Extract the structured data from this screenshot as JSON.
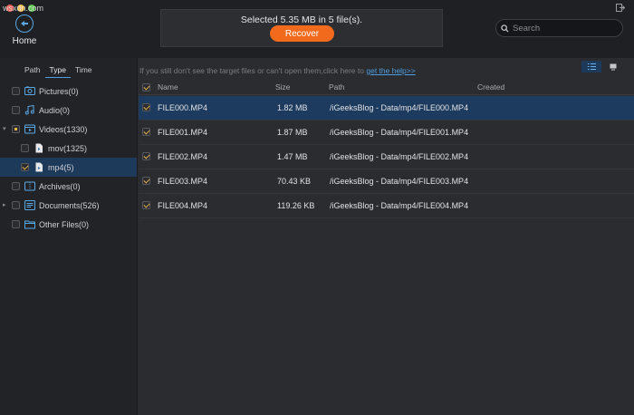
{
  "watermark": "wsxdn.com",
  "header": {
    "home_label": "Home",
    "status_text": "Selected 5.35 MB in 5 file(s).",
    "recover_label": "Recover",
    "search_placeholder": "Search"
  },
  "sidebar": {
    "tabs": [
      "Path",
      "Type",
      "Time"
    ],
    "active_tab": "Type",
    "items": [
      {
        "label": "Pictures(0)",
        "icon": "image-icon",
        "check": "none"
      },
      {
        "label": "Audio(0)",
        "icon": "music-icon",
        "check": "none"
      },
      {
        "label": "Videos(1330)",
        "icon": "video-icon",
        "check": "partial",
        "expanded": true
      },
      {
        "label": "mov(1325)",
        "icon": "file-icon",
        "check": "none",
        "child": true
      },
      {
        "label": "mp4(5)",
        "icon": "file-icon",
        "check": "checked",
        "child": true,
        "selected": true
      },
      {
        "label": "Archives(0)",
        "icon": "archive-icon",
        "check": "none"
      },
      {
        "label": "Documents(526)",
        "icon": "document-icon",
        "check": "none",
        "collapsed": true
      },
      {
        "label": "Other Files(0)",
        "icon": "folder-icon",
        "check": "none"
      }
    ]
  },
  "main": {
    "hint_text": "If you still don't see the target files or can't open them,click here to ",
    "hint_link": "get the help>>",
    "columns": [
      "Name",
      "Size",
      "Path",
      "Created"
    ],
    "rows": [
      {
        "name": "FILE000.MP4",
        "size": "1.82 MB",
        "path": "/iGeeksBlog - Data/mp4/FILE000.MP4",
        "created": "",
        "selected": true
      },
      {
        "name": "FILE001.MP4",
        "size": "1.87 MB",
        "path": "/iGeeksBlog - Data/mp4/FILE001.MP4",
        "created": ""
      },
      {
        "name": "FILE002.MP4",
        "size": "1.47 MB",
        "path": "/iGeeksBlog - Data/mp4/FILE002.MP4",
        "created": ""
      },
      {
        "name": "FILE003.MP4",
        "size": "70.43 KB",
        "path": "/iGeeksBlog - Data/mp4/FILE003.MP4",
        "created": ""
      },
      {
        "name": "FILE004.MP4",
        "size": "119.26 KB",
        "path": "/iGeeksBlog - Data/mp4/FILE004.MP4",
        "created": ""
      }
    ]
  },
  "colors": {
    "accent": "#4f9de0",
    "recover": "#f26a1c",
    "selection": "#1c3b5e",
    "check": "#e8b44a"
  }
}
